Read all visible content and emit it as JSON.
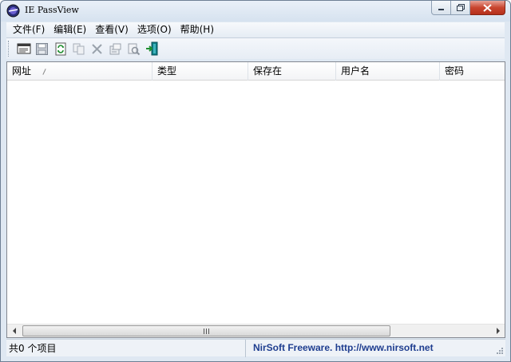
{
  "window": {
    "title": "IE PassView"
  },
  "menu": [
    {
      "label": "文件(F)"
    },
    {
      "label": "编辑(E)"
    },
    {
      "label": "查看(V)"
    },
    {
      "label": "选项(O)"
    },
    {
      "label": "帮助(H)"
    }
  ],
  "toolbar": {
    "buttons": [
      "html-report-icon",
      "save-icon",
      "refresh-icon",
      "copy-icon",
      "delete-icon",
      "properties-icon",
      "find-icon",
      "exit-icon"
    ]
  },
  "list": {
    "columns": [
      "网址",
      "类型",
      "保存在",
      "用户名",
      "密码"
    ],
    "rows": []
  },
  "status": {
    "count_text": "共0 个项目",
    "credit_text": "NirSoft Freeware.  http://www.nirsoft.net"
  },
  "colors": {
    "credit_text": "#1e3d8f",
    "close_button": "#c9452f"
  }
}
